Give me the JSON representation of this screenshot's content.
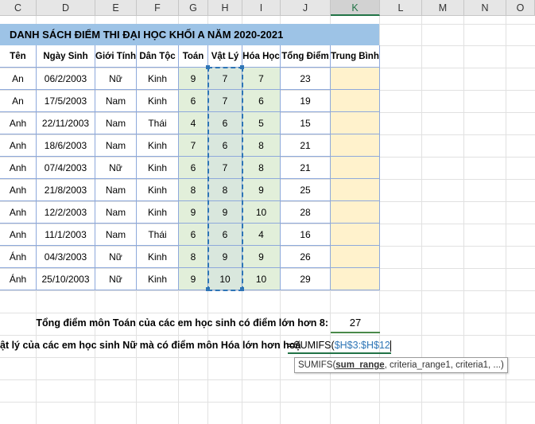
{
  "columns": [
    "C",
    "D",
    "E",
    "F",
    "G",
    "H",
    "I",
    "J",
    "K",
    "L",
    "M",
    "N",
    "O"
  ],
  "title": "DANH SÁCH ĐIỂM THI ĐẠI HỌC KHỐI A NĂM 2020-2021",
  "headers": [
    "Tên",
    "Ngày Sinh",
    "Giới Tính",
    "Dân Tộc",
    "Toán",
    "Vật Lý",
    "Hóa Học",
    "Tổng Điểm",
    "Trung Bình"
  ],
  "rows": [
    [
      "An",
      "06/2/2003",
      "Nữ",
      "Kinh",
      "9",
      "7",
      "7",
      "23",
      ""
    ],
    [
      "An",
      "17/5/2003",
      "Nam",
      "Kinh",
      "6",
      "7",
      "6",
      "19",
      ""
    ],
    [
      "Anh",
      "22/11/2003",
      "Nam",
      "Thái",
      "4",
      "6",
      "5",
      "15",
      ""
    ],
    [
      "Anh",
      "18/6/2003",
      "Nam",
      "Kinh",
      "7",
      "6",
      "8",
      "21",
      ""
    ],
    [
      "Anh",
      "07/4/2003",
      "Nữ",
      "Kinh",
      "6",
      "7",
      "8",
      "21",
      ""
    ],
    [
      "Anh",
      "21/8/2003",
      "Nam",
      "Kinh",
      "8",
      "8",
      "9",
      "25",
      ""
    ],
    [
      "Anh",
      "12/2/2003",
      "Nam",
      "Kinh",
      "9",
      "9",
      "10",
      "28",
      ""
    ],
    [
      "Anh",
      "11/1/2003",
      "Nam",
      "Thái",
      "6",
      "6",
      "4",
      "16",
      ""
    ],
    [
      "Ánh",
      "04/3/2003",
      "Nữ",
      "Kinh",
      "8",
      "9",
      "9",
      "26",
      ""
    ],
    [
      "Ánh",
      "25/10/2003",
      "Nữ",
      "Kinh",
      "9",
      "10",
      "10",
      "29",
      ""
    ]
  ],
  "summary": {
    "label1": "Tổng điểm môn Toán của các em học sinh có điểm lớn hơn 8:",
    "value1": "27",
    "label2": "ật lý của các em học sinh Nữ mà có điểm môn Hóa lớn hơn hoặ",
    "formula_prefix": "=SUMIFS(",
    "formula_ref": "$H$3:$H$12",
    "tooltip_fn": "SUMIFS(",
    "tooltip_arg1": "sum_range",
    "tooltip_rest": ", criteria_range1, criteria1, ...)"
  },
  "colors": {
    "title_bg": "#9dc3e6",
    "green": "#e2efda",
    "yellow": "#fff2cc",
    "border": "#8ea9db"
  }
}
